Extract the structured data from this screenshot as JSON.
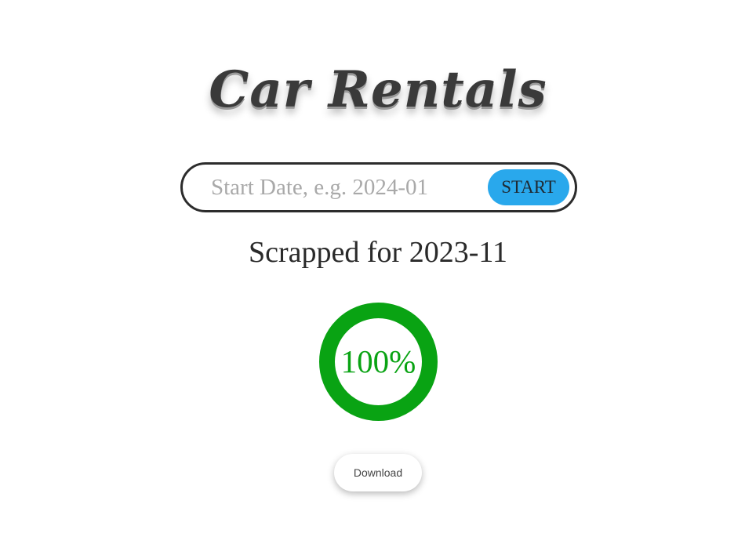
{
  "header": {
    "title": "Car Rentals"
  },
  "search": {
    "placeholder": "Start Date, e.g. 2024-01",
    "value": "",
    "start_label": "START"
  },
  "status": {
    "text": "Scrapped for 2023-11"
  },
  "progress": {
    "value": 1.0,
    "label": "100%",
    "color": "#09a313",
    "track_color": "#e6e6e6"
  },
  "actions": {
    "download_label": "Download"
  },
  "colors": {
    "accent": "#29a8ec",
    "title": "#3a3a3a",
    "success": "#09a313"
  }
}
